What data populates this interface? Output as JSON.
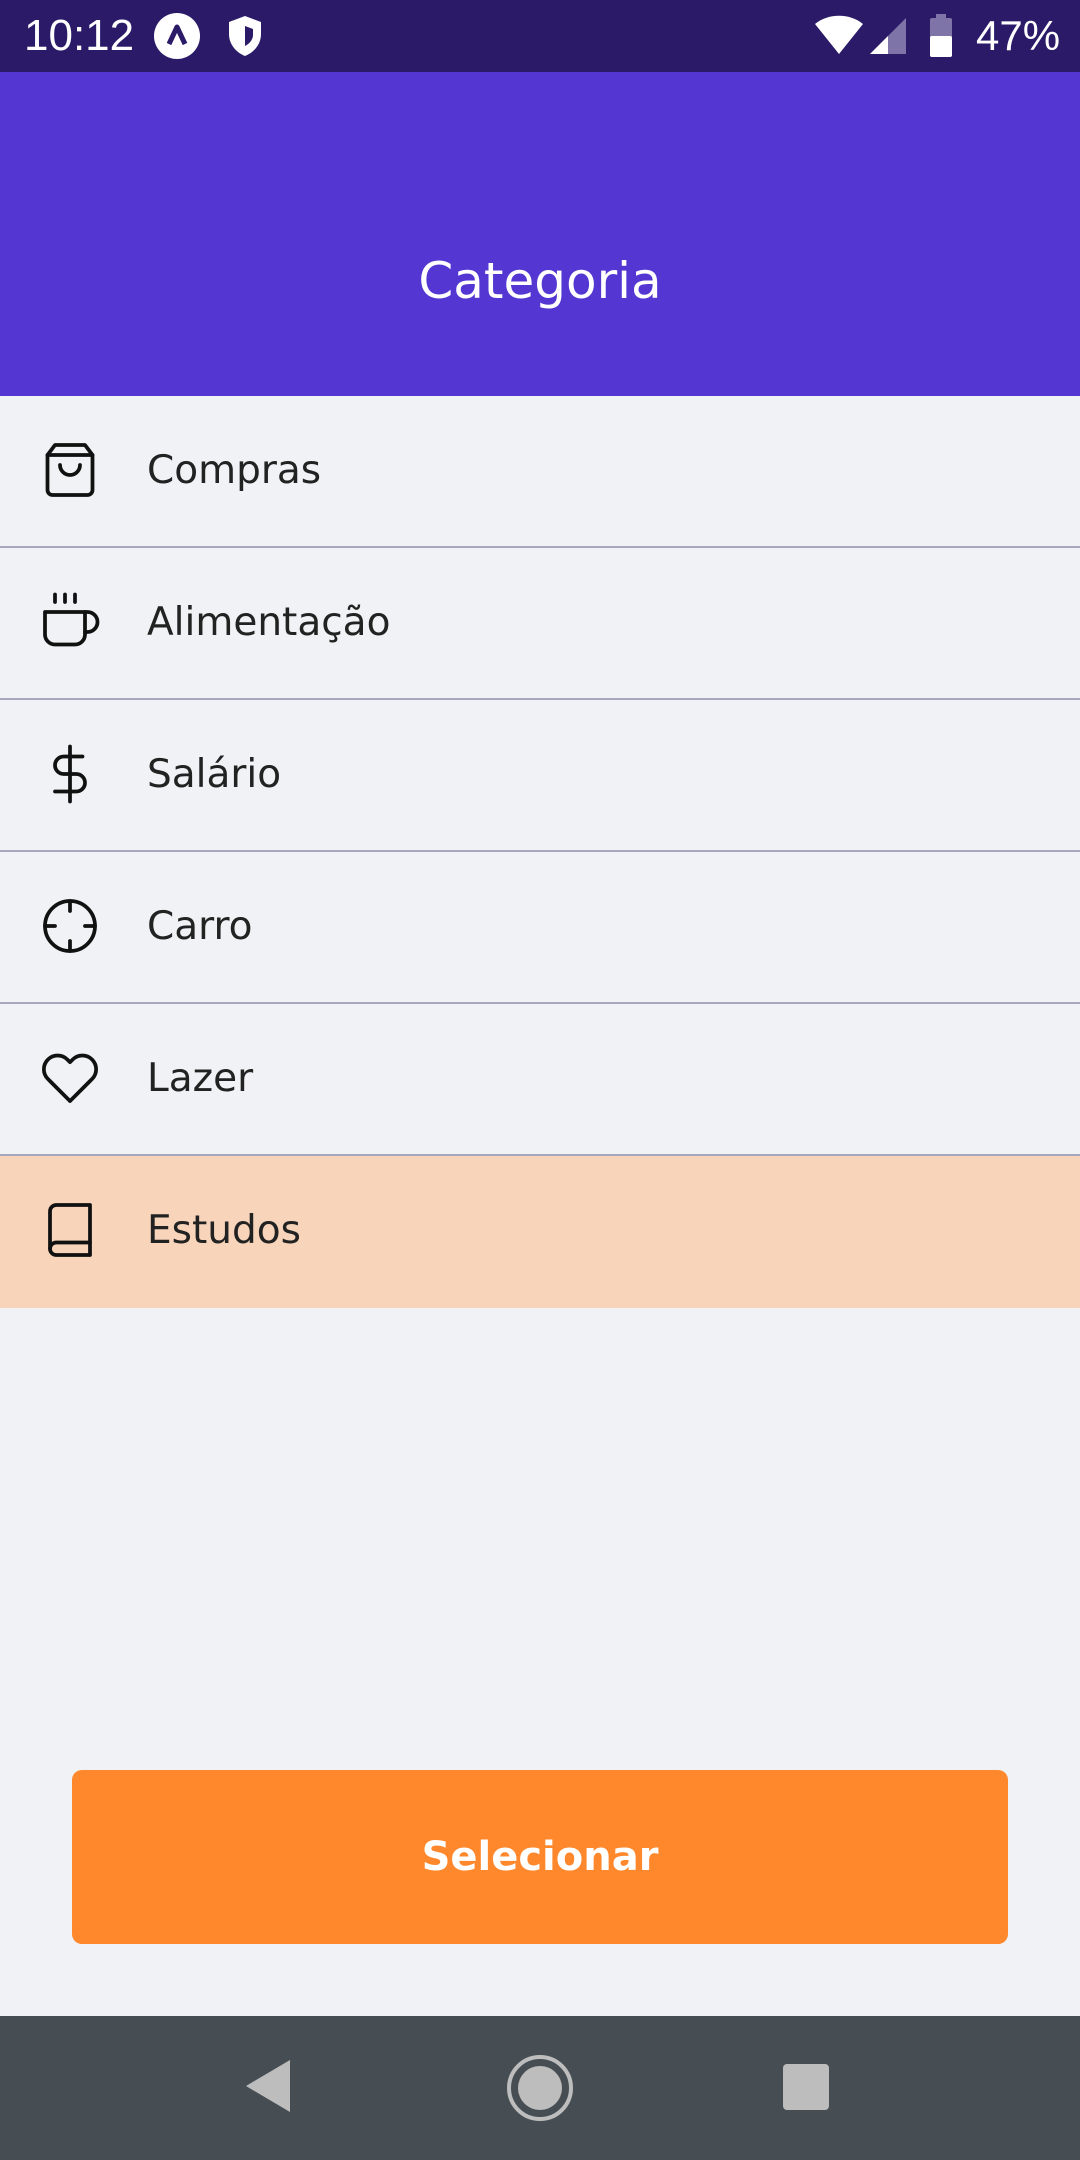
{
  "status_bar": {
    "time": "10:12",
    "battery": "47%",
    "icons": [
      "app-a-icon",
      "shield-icon",
      "wifi-icon",
      "signal-icon",
      "battery-icon"
    ]
  },
  "header": {
    "title": "Categoria"
  },
  "categories": [
    {
      "label": "Compras",
      "icon": "shopping-bag-icon"
    },
    {
      "label": "Alimentação",
      "icon": "coffee-icon"
    },
    {
      "label": "Salário",
      "icon": "dollar-sign-icon"
    },
    {
      "label": "Carro",
      "icon": "crosshair-icon"
    },
    {
      "label": "Lazer",
      "icon": "heart-icon"
    },
    {
      "label": "Estudos",
      "icon": "book-icon",
      "selected": true
    }
  ],
  "select_button": {
    "label": "Selecionar"
  },
  "nav_bar": {
    "icons": [
      "back-icon",
      "home-icon",
      "recents-icon"
    ]
  },
  "colors": {
    "status_bar": "#2A1A68",
    "header": "#5436D2",
    "selected_row": "#F7D4BA",
    "button": "#FF872C",
    "background": "#F0F2F5",
    "nav_bar": "#464E53"
  }
}
